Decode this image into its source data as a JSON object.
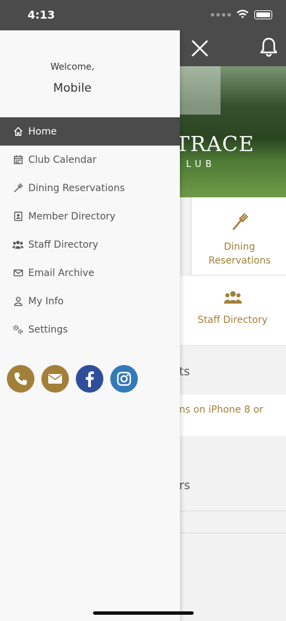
{
  "status_bar": {
    "time": "4:13"
  },
  "drawer": {
    "welcome": "Welcome,",
    "member_name": "Mobile",
    "menu": [
      {
        "label": "Home",
        "icon": "home-icon",
        "active": true
      },
      {
        "label": "Club Calendar",
        "icon": "calendar-icon"
      },
      {
        "label": "Dining Reservations",
        "icon": "fork-icon"
      },
      {
        "label": "Member Directory",
        "icon": "contact-card-icon"
      },
      {
        "label": "Staff Directory",
        "icon": "group-icon"
      },
      {
        "label": "Email Archive",
        "icon": "envelope-icon"
      },
      {
        "label": "My Info",
        "icon": "user-icon"
      },
      {
        "label": "Settings",
        "icon": "gears-icon"
      }
    ],
    "social": [
      "phone-icon",
      "mail-icon",
      "facebook-icon",
      "instagram-icon"
    ]
  },
  "background": {
    "hero_logo": "TRACE",
    "hero_logo_sub": "LUB",
    "tiles": {
      "dining_label": "Dining Reservations",
      "staff_label": "Staff Directory"
    },
    "section_1_title": "ts",
    "section_1_row": "ns on iPhone 8 or",
    "section_2_title": "rs"
  },
  "colors": {
    "accent": "#a3803a",
    "header": "#4b4b4b",
    "facebook": "#2e4e9a",
    "instagram": "#3479b8"
  }
}
